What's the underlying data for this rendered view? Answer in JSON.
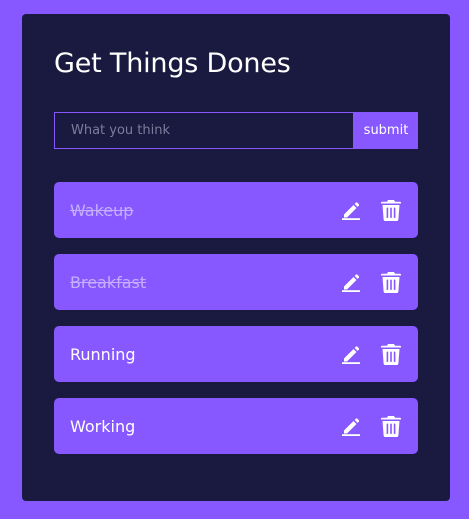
{
  "app": {
    "title": "Get Things Dones"
  },
  "form": {
    "placeholder": "What you think",
    "value": "",
    "submit_label": "submit"
  },
  "todos": [
    {
      "task": "Wakeup",
      "completed": true
    },
    {
      "task": "Breakfast",
      "completed": true
    },
    {
      "task": "Running",
      "completed": false
    },
    {
      "task": "Working",
      "completed": false
    }
  ],
  "icons": {
    "edit": "pen-to-square-icon",
    "delete": "trash-icon"
  },
  "colors": {
    "background": "#8758ff",
    "card": "#1a1a40",
    "accent": "#8758ff",
    "text": "#ffffff",
    "completed_text": "#c5aeff",
    "placeholder": "#7c7c9c"
  }
}
